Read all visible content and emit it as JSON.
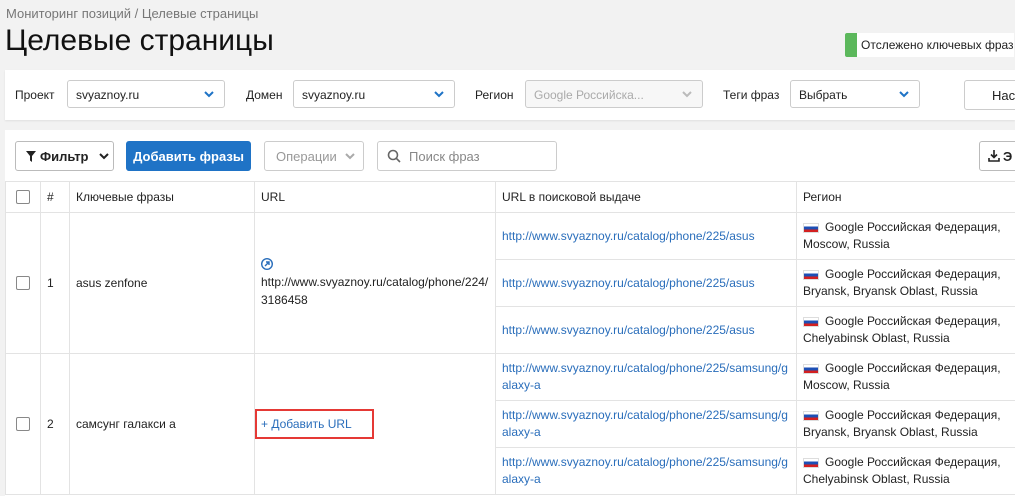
{
  "breadcrumb": "Мониторинг позиций / Целевые страницы",
  "title": "Целевые страницы",
  "tracked_label": "Отслежено ключевых фраз",
  "filters": {
    "project_label": "Проект",
    "project_value": "svyaznoy.ru",
    "domain_label": "Домен",
    "domain_value": "svyaznoy.ru",
    "region_label": "Регион",
    "region_value": "Google Российска...",
    "tags_label": "Теги фраз",
    "tags_value": "Выбрать",
    "settings_label": "Нас"
  },
  "toolbar": {
    "filter_label": "Фильтр",
    "add_phrases_label": "Добавить фразы",
    "operations_label": "Операции",
    "search_placeholder": "Поиск фраз",
    "export_label": "Э"
  },
  "table": {
    "headers": {
      "num": "#",
      "phrase": "Ключевые фразы",
      "url": "URL",
      "serp_url": "URL в поисковой выдаче",
      "region": "Регион"
    },
    "rows": [
      {
        "num": "1",
        "phrase": "asus zenfone",
        "target_url": "http://www.svyaznoy.ru/catalog/phone/224/3186458",
        "sub": [
          {
            "serp_url": "http://www.svyaznoy.ru/catalog/phone/225/asus",
            "region_1": "Google Российская Федерация,",
            "region_2": "Moscow, Russia"
          },
          {
            "serp_url": "http://www.svyaznoy.ru/catalog/phone/225/asus",
            "region_1": "Google Российская Федерация,",
            "region_2": "Bryansk, Bryansk Oblast, Russia"
          },
          {
            "serp_url": "http://www.svyaznoy.ru/catalog/phone/225/asus",
            "region_1": "Google Российская Федерация,",
            "region_2": "Chelyabinsk Oblast, Russia"
          }
        ]
      },
      {
        "num": "2",
        "phrase": "самсунг галакси а",
        "add_url_label": "+ Добавить URL",
        "sub": [
          {
            "serp_url": "http://www.svyaznoy.ru/catalog/phone/225/samsung/galaxy-a",
            "region_1": "Google Российская Федерация,",
            "region_2": "Moscow, Russia"
          },
          {
            "serp_url": "http://www.svyaznoy.ru/catalog/phone/225/samsung/galaxy-a",
            "region_1": "Google Российская Федерация,",
            "region_2": "Bryansk, Bryansk Oblast, Russia"
          },
          {
            "serp_url": "http://www.svyaznoy.ru/catalog/phone/225/samsung/galaxy-a",
            "region_1": "Google Российская Федерация,",
            "region_2": "Chelyabinsk Oblast, Russia"
          }
        ]
      }
    ]
  },
  "colors": {
    "primary": "#1f73c6",
    "link": "#2a6ebb",
    "tracked_green": "#5cb85c",
    "highlight_red": "#e53935"
  }
}
